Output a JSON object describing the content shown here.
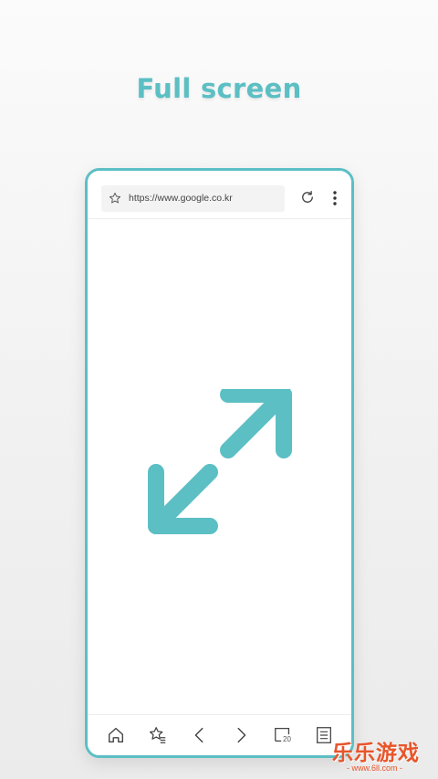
{
  "headline": "Full screen",
  "browser": {
    "url": "https://www.google.co.kr",
    "icons": {
      "bookmark": "star-icon",
      "reload": "reload-icon",
      "menu": "more-vertical-icon",
      "feature": "expand-diagonal-icon"
    },
    "bottom_bar": {
      "tab_count": "20",
      "items": [
        "home-icon",
        "bookmarks-icon",
        "back-icon",
        "forward-icon",
        "tabs-icon",
        "list-menu-icon"
      ]
    }
  },
  "accent_color": "#5bbfc4",
  "watermark": {
    "text": "乐乐游戏",
    "url": "- www.6ll.com -",
    "color": "#e8552b"
  }
}
